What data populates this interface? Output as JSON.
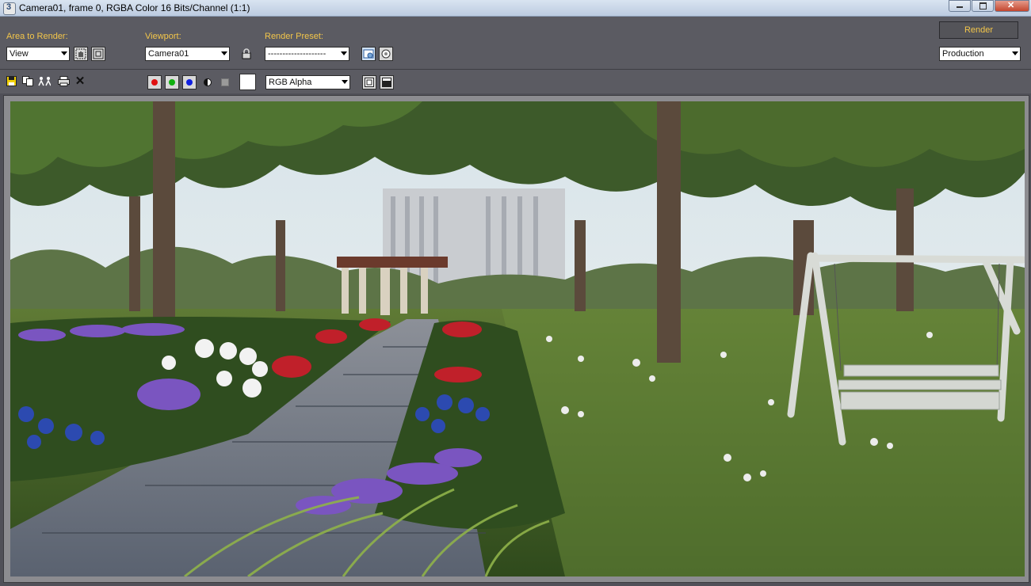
{
  "window": {
    "title": "Camera01, frame 0, RGBA Color 16 Bits/Channel (1:1)"
  },
  "area_to_render": {
    "label": "Area to Render:",
    "value": "View"
  },
  "viewport": {
    "label": "Viewport:",
    "value": "Camera01"
  },
  "render_preset": {
    "label": "Render Preset:",
    "value": "--------------------"
  },
  "render_button": {
    "label": "Render"
  },
  "render_mode": {
    "value": "Production"
  },
  "channel_display": {
    "value": "RGB Alpha"
  },
  "colors": {
    "panel_bg": "#5b5b62",
    "label_accent": "#f3c64a",
    "red_channel": "#e01010",
    "green_channel": "#10b010",
    "blue_channel": "#1020e0"
  },
  "icons": [
    "save-image-icon",
    "copy-image-icon",
    "clone-frame-buffer-icon",
    "print-image-icon",
    "clear-icon",
    "lock-icon",
    "environment-icon",
    "render-setup-icon",
    "mono-channel-icon",
    "alpha-channel-icon"
  ]
}
